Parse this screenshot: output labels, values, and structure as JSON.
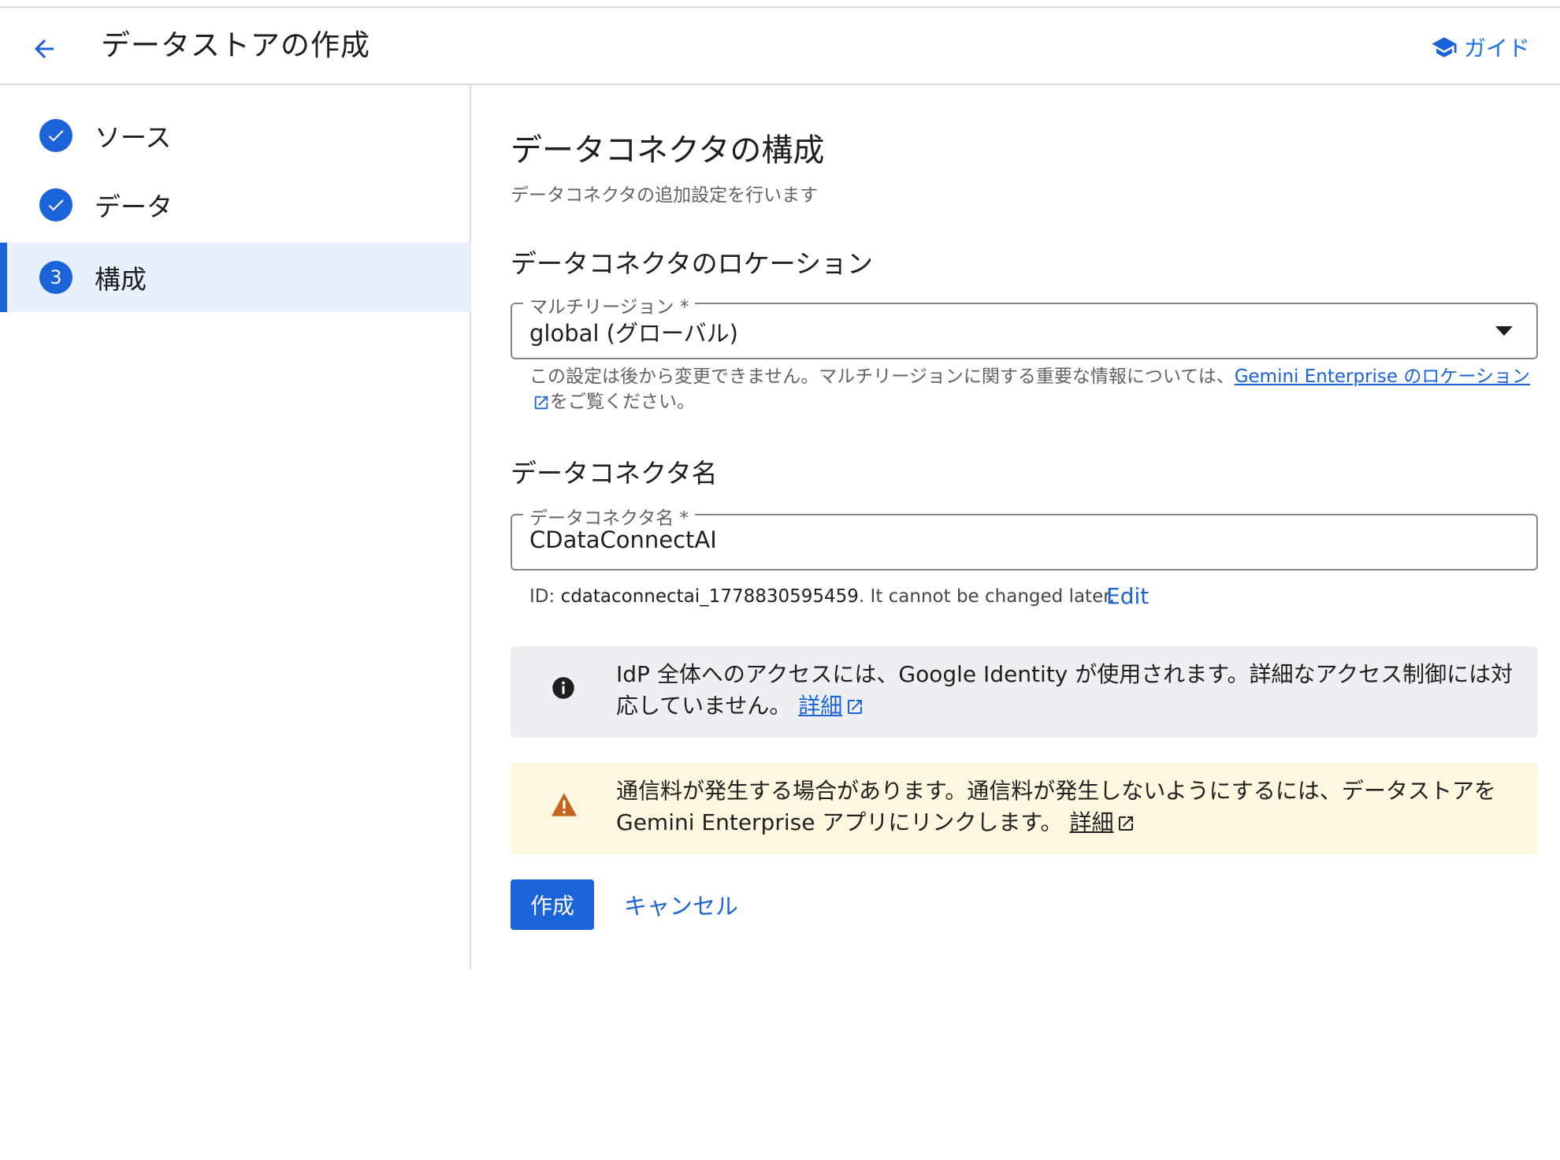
{
  "header": {
    "title": "データストアの作成",
    "guide_label": "ガイド"
  },
  "steps": [
    {
      "label": "ソース",
      "status": "done"
    },
    {
      "label": "データ",
      "status": "done"
    },
    {
      "label": "構成",
      "status": "active",
      "number": "3"
    }
  ],
  "main": {
    "title": "データコネクタの構成",
    "subtitle": "データコネクタの追加設定を行います",
    "location": {
      "heading": "データコネクタのロケーション",
      "field_label": "マルチリージョン *",
      "field_value": "global (グローバル)",
      "hint_text": "この設定は後から変更できません。マルチリージョンに関する重要な情報については、",
      "hint_link": "Gemini Enterprise のロケーション",
      "hint_suffix": "をご覧ください。"
    },
    "name": {
      "heading": "データコネクタ名",
      "field_label": "データコネクタ名 *",
      "field_value": "CDataConnectAI",
      "id_prefix": "ID: ",
      "id_value": "cdataconnectai_1778830595459",
      "id_suffix": ". It cannot be changed later.",
      "edit_label": "Edit"
    },
    "info_banner": {
      "text": "IdP 全体へのアクセスには、Google Identity が使用されます。詳細なアクセス制御には対応していません。",
      "link": "詳細"
    },
    "warning_banner": {
      "text": "通信料が発生する場合があります。通信料が発生しないようにするには、データストアを Gemini Enterprise アプリにリンクします。",
      "link": "詳細"
    },
    "create_label": "作成",
    "cancel_label": "キャンセル"
  },
  "colors": {
    "accent": "#1a63d8",
    "active_step_bg": "#e8f0fe",
    "info_bg": "#edeff3",
    "warning_bg": "#fef7e0",
    "warning_icon": "#c5621c"
  }
}
